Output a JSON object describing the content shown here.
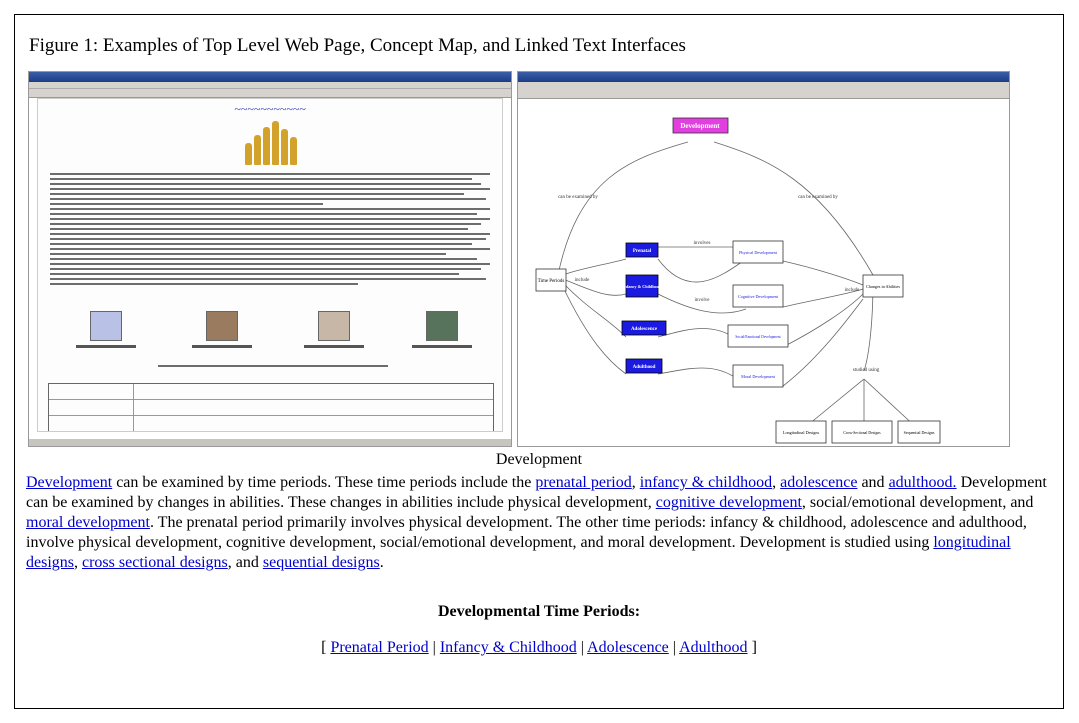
{
  "figure": {
    "caption": "Figure 1: Examples of Top Level Web Page, Concept Map, and Linked Text Interfaces"
  },
  "concept_map": {
    "nodes": {
      "development": "Development",
      "prenatal": "Prenatal",
      "infancy": "Infancy & Childhood",
      "adolescence": "Adolescence",
      "adulthood": "Adulthood",
      "physical": "Physical Development",
      "cognitive": "Cognitive Development",
      "social": "Social/Emotional Development",
      "moral": "Moral Development",
      "time_periods": "Time Periods",
      "changes": "Changes in Abilities",
      "longitudinal": "Longitudinal Designs",
      "cross_sectional": "Cross-Sectional Designs",
      "sequential": "Sequential Designs"
    },
    "links": {
      "can_be_examined_by_left": "can be examined by",
      "can_be_examined_by_right": "can be examined by",
      "involves": "involves",
      "include_left": "include",
      "include_right": "include",
      "involve": "involve",
      "studied_using": "studied using"
    }
  },
  "linked_text": {
    "heading": "Development",
    "segments": [
      {
        "text": "Development",
        "link": true
      },
      {
        "text": " can be examined by time periods. These time periods include the ",
        "link": false
      },
      {
        "text": "prenatal period",
        "link": true
      },
      {
        "text": ", ",
        "link": false
      },
      {
        "text": "infancy & childhood",
        "link": true
      },
      {
        "text": ", ",
        "link": false
      },
      {
        "text": "adolescence",
        "link": true
      },
      {
        "text": " and ",
        "link": false
      },
      {
        "text": "adulthood.",
        "link": true
      },
      {
        "text": " Development can be examined by changes in abilities. These changes in abilities include physical development, ",
        "link": false
      },
      {
        "text": "cognitive development",
        "link": true
      },
      {
        "text": ", social/emotional development, and ",
        "link": false
      },
      {
        "text": "moral development",
        "link": true
      },
      {
        "text": ". The prenatal period primarily involves physical development. The other time periods: infancy & childhood, adolescence and adulthood, involve physical development, cognitive development, social/emotional development, and moral development. Development is studied using ",
        "link": false
      },
      {
        "text": "longitudinal designs",
        "link": true
      },
      {
        "text": ", ",
        "link": false
      },
      {
        "text": "cross sectional designs",
        "link": true
      },
      {
        "text": ", and ",
        "link": false
      },
      {
        "text": "sequential designs",
        "link": true
      },
      {
        "text": ".",
        "link": false
      }
    ],
    "subheading": "Developmental Time Periods:",
    "nav": {
      "open": "[",
      "sep": "|",
      "close": "]",
      "items": [
        "Prenatal Period",
        "Infancy & Childhood",
        "Adolescence",
        "Adulthood"
      ]
    }
  }
}
